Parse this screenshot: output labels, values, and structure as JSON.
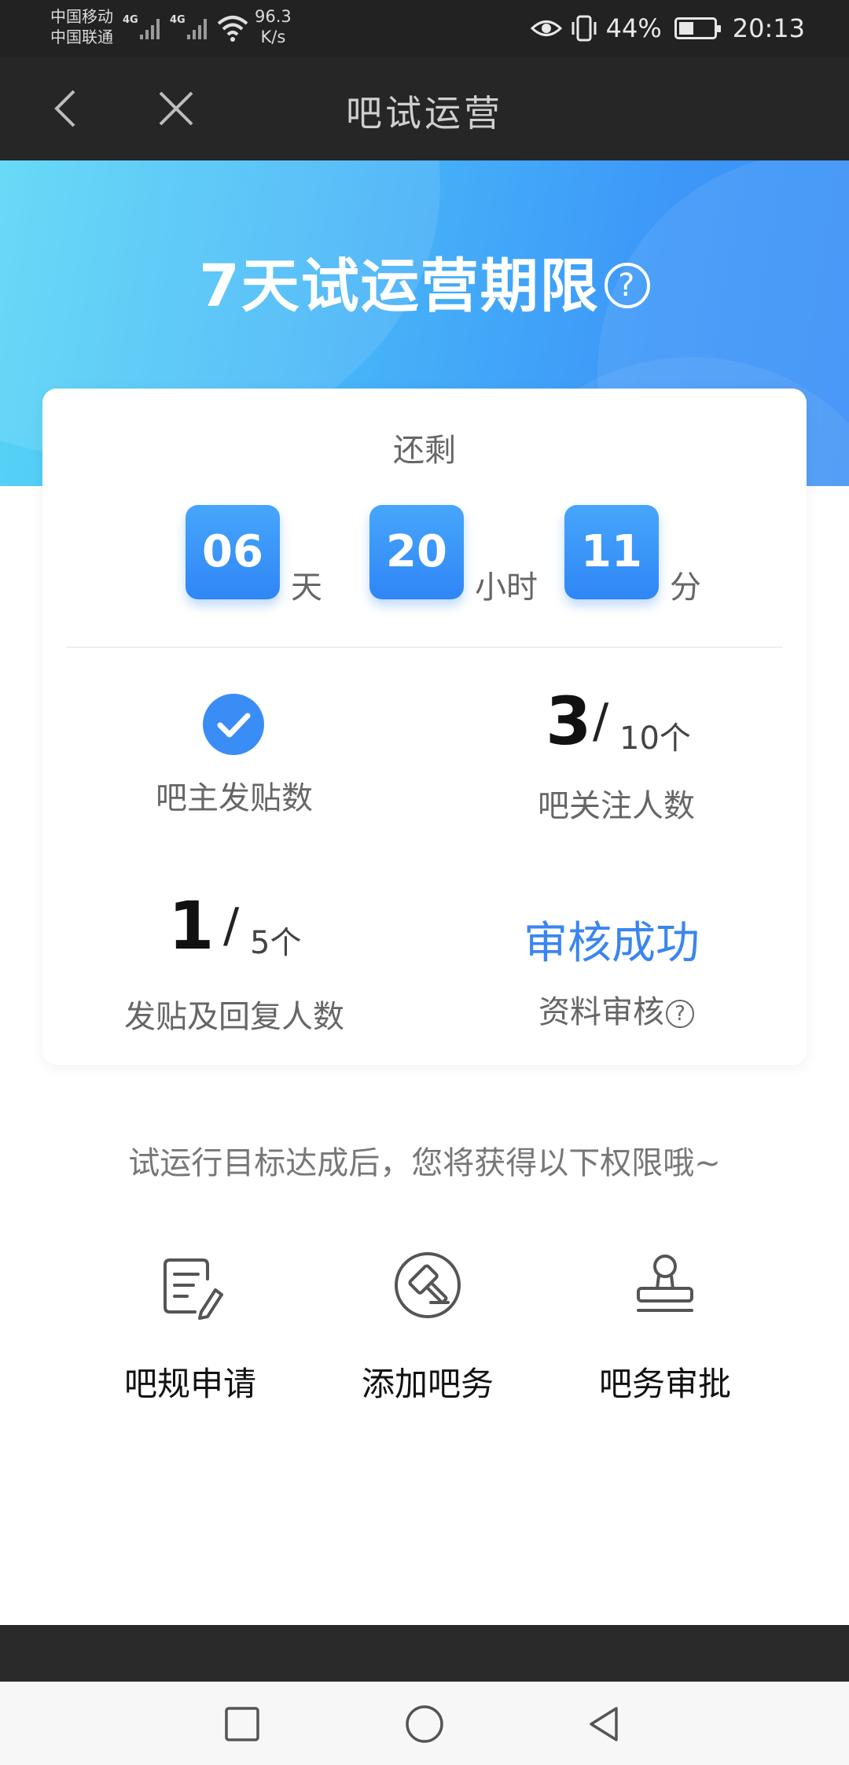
{
  "status_bar": {
    "carrier1": "中国移动",
    "carrier2": "中国联通",
    "signal1_label": "4G",
    "signal2_label": "4G",
    "speed_value": "96.3",
    "speed_unit": "K/s",
    "battery": "44%",
    "battery_level": 0.44,
    "time": "20:13"
  },
  "nav": {
    "title": "吧试运营"
  },
  "hero": {
    "title": "7天试运营期限"
  },
  "countdown": {
    "label": "还剩",
    "days": "06",
    "days_unit": "天",
    "hours": "20",
    "hours_unit": "小时",
    "minutes": "11",
    "minutes_unit": "分"
  },
  "stats": {
    "owner_posts": {
      "label": "吧主发贴数",
      "status": "done"
    },
    "followers": {
      "current": "3",
      "target": "10个",
      "label": "吧关注人数"
    },
    "posters": {
      "current": "1",
      "target": "5个",
      "label": "发贴及回复人数"
    },
    "profile_review": {
      "status": "审核成功",
      "label": "资料审核"
    }
  },
  "hint": "试运行目标达成后，您将获得以下权限哦~",
  "permissions": [
    {
      "label": "吧规申请",
      "icon": "document-edit-icon"
    },
    {
      "label": "添加吧务",
      "icon": "gavel-icon"
    },
    {
      "label": "吧务审批",
      "icon": "stamp-icon"
    }
  ],
  "colors": {
    "accent": "#3a86ef",
    "hero_start": "#57d6f6",
    "hero_end": "#3a8ff7"
  }
}
